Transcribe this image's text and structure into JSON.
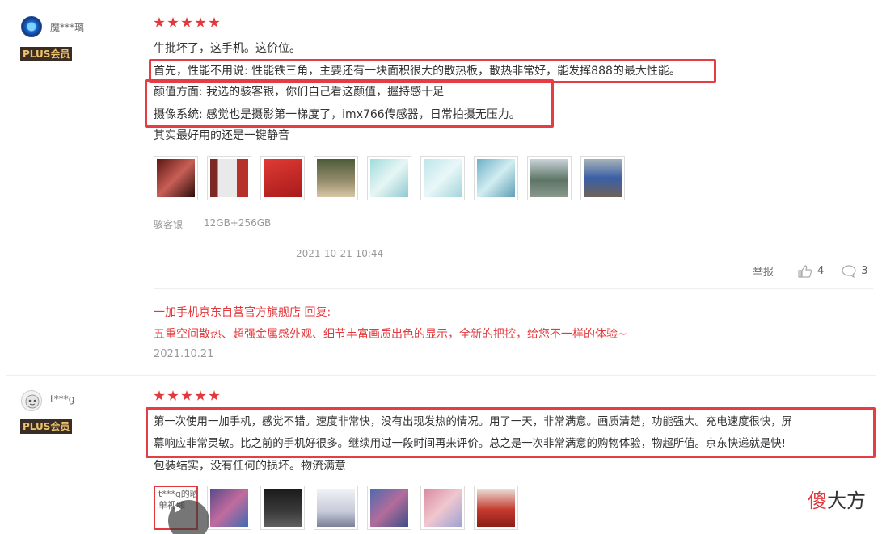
{
  "review1": {
    "username": "魔***璃",
    "badge": "PLUS会员",
    "rating": 5,
    "lines": [
      "牛批坏了，这手机。这价位。",
      "首先，性能不用说: 性能铁三角，主要还有一块面积很大的散热板，散热非常好，能发挥888的最大性能。",
      "颜值方面: 我选的骇客银，你们自己看这颜值，握持感十足",
      "摄像系统: 感觉也是摄影第一梯度了，imx766传感器，日常拍摄无压力。",
      "其实最好用的还是一键静音"
    ],
    "color": "骇客银",
    "spec": "12GB+256GB",
    "datetime": "2021-10-21 10:44",
    "report_label": "举报",
    "likes": "4",
    "comments": "3",
    "reply_head": "一加手机京东自营官方旗舰店 回复:",
    "reply_body": "五重空间散热、超强金属感外观、细节丰富画质出色的显示，全新的把控，给您不一样的体验~",
    "reply_date": "2021.10.21",
    "thumb_colors": [
      "#8a2a25",
      "#c8463e",
      "#d8312f",
      "#7a7a55",
      "#8fd0d0",
      "#aee0e3",
      "#7fbfd1",
      "#6f8a7a",
      "#4a6ba8"
    ]
  },
  "review2": {
    "username": "t***g",
    "badge": "PLUS会员",
    "rating": 5,
    "lines": [
      "第一次使用一加手机，感觉不错。速度非常快，没有出现发热的情况。用了一天，非常满意。画质清楚，功能强大。充电速度很快，屏",
      "幕响应非常灵敏。比之前的手机好很多。继续用过一段时间再来评价。总之是一次非常满意的购物体验，物超所值。京东快递就是快!",
      "包装结实，没有任何的损坏。物流满意"
    ],
    "video_label": "t***g的晒单视频",
    "thumb_colors": [
      "#8b6db3",
      "#2d2d2d",
      "#d9dde8",
      "#6e7fb8",
      "#c97b8b",
      "#c33a2e"
    ]
  },
  "watermark": {
    "part1": "傻",
    "part2": "大方"
  }
}
